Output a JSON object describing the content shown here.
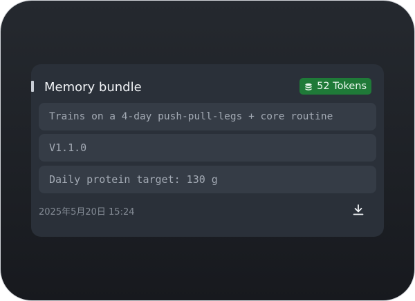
{
  "card": {
    "title": "Memory bundle",
    "token_badge": {
      "icon": "database-icon",
      "label": "52 Tokens",
      "color": "#1f7a38"
    },
    "entries": [
      "Trains on a 4-day push-pull-legs + core routine",
      "V1.1.0",
      "Daily protein target: 130 g"
    ],
    "timestamp": "2025年5月20日 15:24",
    "download_icon": "download-icon"
  }
}
